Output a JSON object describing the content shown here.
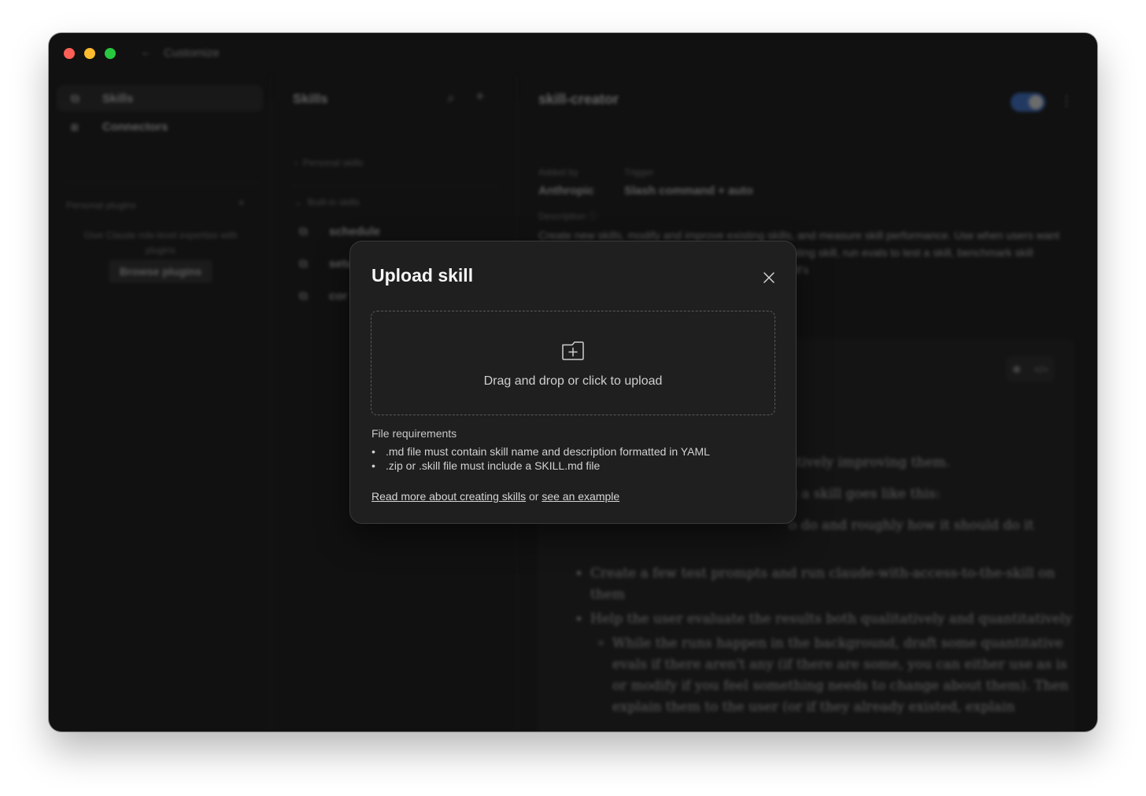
{
  "window": {
    "title": "Customize",
    "traffic_colors": [
      "#fe5f57",
      "#febc2e",
      "#28c840"
    ]
  },
  "sidebar": {
    "items": [
      {
        "label": "Skills",
        "icon": "skills-icon",
        "active": true
      },
      {
        "label": "Connectors",
        "icon": "connectors-icon",
        "active": false
      }
    ],
    "section_label": "Personal plugins",
    "description": "Give Claude role-level expertise with plugins",
    "browse_button": "Browse plugins"
  },
  "skills_list": {
    "title": "Skills",
    "personal_group": "Personal skills",
    "builtin_group": "Built-in skills",
    "items": [
      "schedule",
      "setup-cowork",
      "cor"
    ]
  },
  "detail": {
    "title": "skill-creator",
    "added_by_label": "Added by",
    "added_by_value": "Anthropic",
    "trigger_label": "Trigger",
    "trigger_value": "Slash command + auto",
    "description_label": "Description",
    "description": "Create new skills, modify and improve existing skills, and measure skill performance. Use when users want to create a skill from scratch, edit, or optimize an existing skill, run evals to test a skill, benchmark skill performance with variance analysis, or optimize a skill's",
    "content": {
      "line1": "atively improving them.",
      "line2": "g a skill goes like this:",
      "line3": "o do and roughly how it should do it",
      "bullet1": "Create a few test prompts and run claude-with-access-to-the-skill on them",
      "bullet2": "Help the user evaluate the results both qualitatively and quantitatively",
      "sub1": "While the runs happen in the background, draft some quantitative evals if there aren't any (if there are some, you can either use as is or modify if you feel something needs to change about them). Then explain them to the user (or if they already existed, explain"
    }
  },
  "dialog": {
    "title": "Upload skill",
    "dropzone_text": "Drag and drop or click to upload",
    "requirements_title": "File requirements",
    "requirements": [
      ".md file must contain skill name and description formatted in YAML",
      ".zip or .skill file must include a SKILL.md file"
    ],
    "link_read_more": "Read more about creating skills",
    "link_connector": "or",
    "link_example": "see an example"
  }
}
